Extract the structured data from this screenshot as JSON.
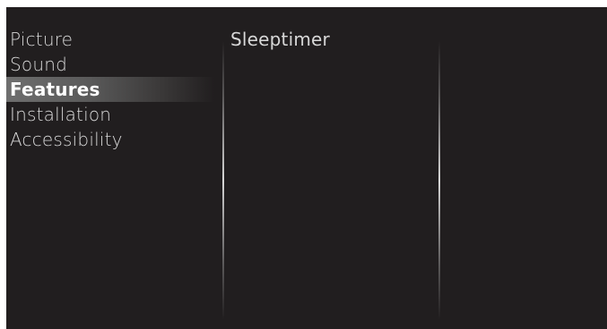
{
  "menu": {
    "items": [
      {
        "label": "Picture"
      },
      {
        "label": "Sound"
      },
      {
        "label": "Features"
      },
      {
        "label": "Installation"
      },
      {
        "label": "Accessibility"
      }
    ],
    "selected": "Features"
  },
  "submenu": {
    "items": [
      {
        "label": "Sleeptimer"
      }
    ]
  },
  "colors": {
    "background": "#211e1f",
    "text": "#d8d8d8",
    "selected_text": "#ffffff",
    "highlight": "#6e6e6e"
  }
}
